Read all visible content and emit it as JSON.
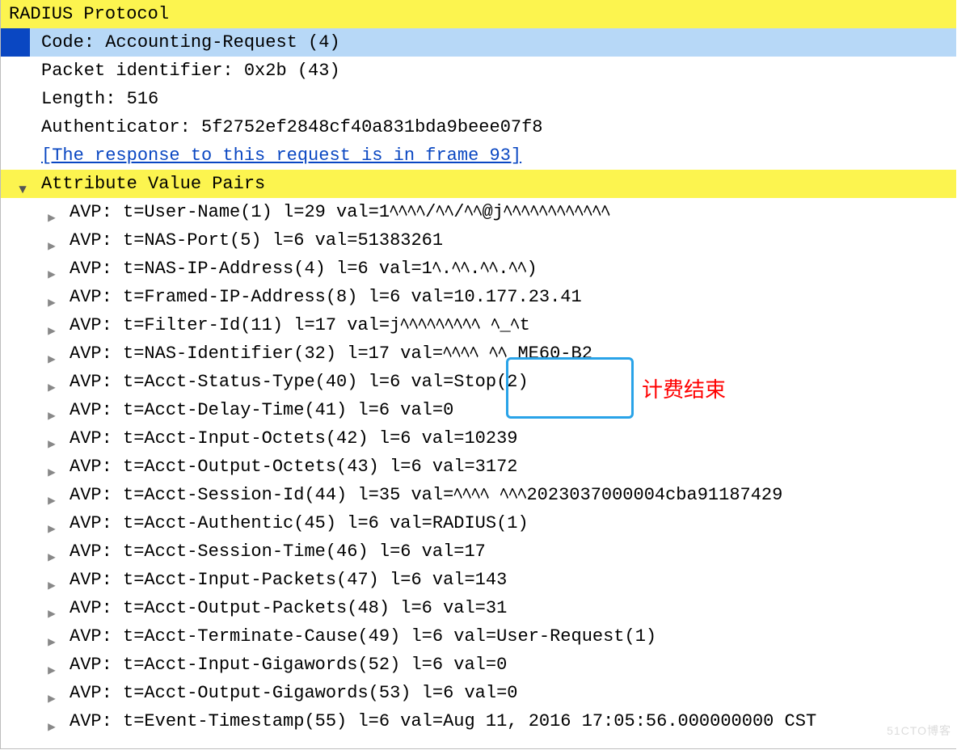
{
  "protocol_header": "RADIUS Protocol",
  "fields": {
    "code": "Code: Accounting-Request (4)",
    "packet_id": "Packet identifier: 0x2b (43)",
    "length": "Length: 516",
    "authenticator": "Authenticator: 5f2752ef2848cf40a831bda9beee07f8",
    "response_link": "[The response to this request is in frame 93]"
  },
  "avp_section": "Attribute Value Pairs",
  "avps": [
    "AVP: t=User-Name(1) l=29 val=1ﾍﾍﾍﾍ/ﾍﾍ/ﾍﾍ@jﾍﾍﾍﾍﾍﾍﾍﾍﾍﾍﾍﾍ",
    "AVP: t=NAS-Port(5) l=6 val=51383261",
    "AVP: t=NAS-IP-Address(4) l=6 val=1ﾍ.ﾍﾍ.ﾍﾍ.ﾍﾍ)",
    "AVP: t=Framed-IP-Address(8) l=6 val=10.177.23.41",
    "AVP: t=Filter-Id(11) l=17 val=jﾍﾍﾍﾍﾍﾍﾍﾍﾍ ﾍ_ﾍt",
    "AVP: t=NAS-Identifier(32) l=17 val=ﾍﾍﾍﾍ ﾍﾍ ME60-B2",
    "AVP: t=Acct-Status-Type(40) l=6 val=Stop(2)",
    "AVP: t=Acct-Delay-Time(41) l=6 val=0",
    "AVP: t=Acct-Input-Octets(42) l=6 val=10239",
    "AVP: t=Acct-Output-Octets(43) l=6 val=3172",
    "AVP: t=Acct-Session-Id(44) l=35 val=ﾍﾍﾍﾍ ﾍﾍﾍ2023037000004cba91187429",
    "AVP: t=Acct-Authentic(45) l=6 val=RADIUS(1)",
    "AVP: t=Acct-Session-Time(46) l=6 val=17",
    "AVP: t=Acct-Input-Packets(47) l=6 val=143",
    "AVP: t=Acct-Output-Packets(48) l=6 val=31",
    "AVP: t=Acct-Terminate-Cause(49) l=6 val=User-Request(1)",
    "AVP: t=Acct-Input-Gigawords(52) l=6 val=0",
    "AVP: t=Acct-Output-Gigawords(53) l=6 val=0",
    "AVP: t=Event-Timestamp(55) l=6 val=Aug 11, 2016 17:05:56.000000000 CST"
  ],
  "annotation": {
    "label": "计费结束"
  },
  "watermark": "51CTO博客"
}
